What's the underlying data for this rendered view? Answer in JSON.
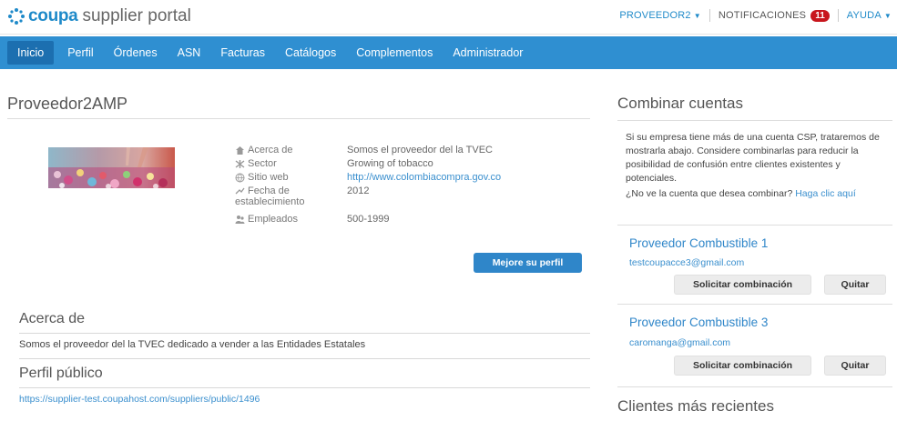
{
  "header": {
    "logo_brand": "coupa",
    "logo_rest": "supplier portal",
    "user_menu": "PROVEEDOR2",
    "notifications_label": "NOTIFICACIONES",
    "notifications_count": "11",
    "help_menu": "AYUDA"
  },
  "nav": {
    "items": [
      "Inicio",
      "Perfil",
      "Órdenes",
      "ASN",
      "Facturas",
      "Catálogos",
      "Complementos",
      "Administrador"
    ],
    "active": "Inicio"
  },
  "profile": {
    "name": "Proveedor2AMP",
    "fields": [
      {
        "label": "Acerca de",
        "value": "Somos el proveedor del la TVEC",
        "icon": "home-icon"
      },
      {
        "label": "Sector",
        "value": "Growing of tobacco",
        "icon": "sector-icon"
      },
      {
        "label": "Sitio web",
        "value": "http://www.colombiacompra.gov.co",
        "icon": "globe-icon"
      },
      {
        "label": "Fecha de establecimiento",
        "label_line1": "Fecha de",
        "label_line2": "establecimiento",
        "value": "2012",
        "icon": "calendar-icon"
      },
      {
        "label": "Empleados",
        "value": "500-1999",
        "icon": "people-icon"
      }
    ],
    "improve_button": "Mejore su perfil"
  },
  "about": {
    "title": "Acerca de",
    "text": "Somos el proveedor del la TVEC dedicado a vender a las Entidades Estatales"
  },
  "public_profile": {
    "title": "Perfil público",
    "url": "https://supplier-test.coupahost.com/suppliers/public/1496"
  },
  "combine": {
    "title": "Combinar cuentas",
    "description": "Si su empresa tiene más de una cuenta CSP, trataremos de mostrarla abajo. Considere combinarlas para reducir la posibilidad de confusión entre clientes existentes y potenciales.",
    "question": "¿No ve la cuenta que desea combinar?",
    "question_link": "Haga clic aquí",
    "accounts": [
      {
        "name": "Proveedor Combustible 1",
        "email": "testcoupacce3@gmail.com"
      },
      {
        "name": "Proveedor Combustible 3",
        "email": "caromanga@gmail.com"
      }
    ],
    "request_button": "Solicitar combinación",
    "remove_button": "Quitar"
  },
  "recent_customers": {
    "title": "Clientes más recientes"
  },
  "colors": {
    "nav_blue": "#2f8fd1",
    "nav_active": "#1c6fb0",
    "link_blue": "#3a8fce",
    "badge_red": "#c8161d"
  }
}
